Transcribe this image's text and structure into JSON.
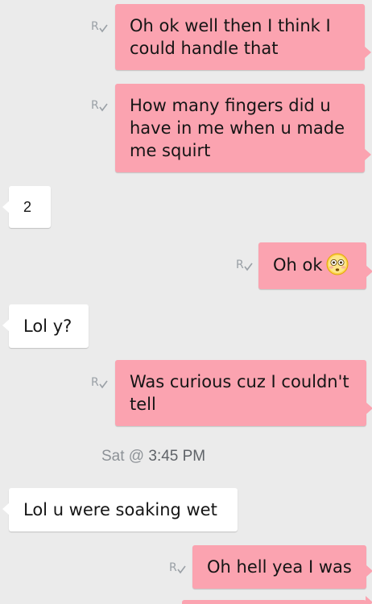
{
  "messages": [
    {
      "from": "me",
      "text": "Oh ok well then I think I could handle that",
      "receipt": "R"
    },
    {
      "from": "me",
      "text": "How many fingers did u have in me when u made me squirt",
      "receipt": "R"
    },
    {
      "from": "them",
      "text": "2"
    },
    {
      "from": "me",
      "text": "Oh ok",
      "emoji": "flushed-face-emoji",
      "receipt": "R"
    },
    {
      "from": "them",
      "text": "Lol y?"
    },
    {
      "from": "me",
      "text": "Was curious cuz I couldn't tell",
      "receipt": "R"
    },
    {
      "from": "them",
      "text": "Lol u were soaking wet"
    },
    {
      "from": "me",
      "text": "Oh hell yea I was",
      "receipt": "R"
    }
  ],
  "timestamp": {
    "day": "Sat @",
    "time": "3:45 PM"
  },
  "colors": {
    "sent_bubble": "#fba3b0",
    "received_bubble": "#ffffff",
    "background": "#ebebeb",
    "timestamp": "#8d9297"
  }
}
